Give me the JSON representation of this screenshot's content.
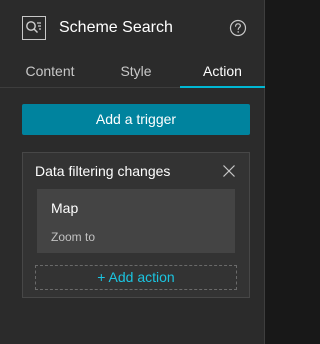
{
  "header": {
    "title": "Scheme Search",
    "app_icon": "search-list-icon",
    "help_icon": "help-icon"
  },
  "tabs": [
    {
      "label": "Content",
      "active": false
    },
    {
      "label": "Style",
      "active": false
    },
    {
      "label": "Action",
      "active": true
    }
  ],
  "add_trigger_label": "Add a trigger",
  "trigger": {
    "title": "Data filtering changes",
    "close_icon": "close-icon",
    "action": {
      "name": "Map",
      "detail": "Zoom to"
    },
    "add_action_label": "+ Add action"
  },
  "colors": {
    "accent": "#00b8d4",
    "button": "#00839e",
    "panel_bg": "#2b2b2b",
    "card_bg": "#333333",
    "item_bg": "#444444"
  }
}
